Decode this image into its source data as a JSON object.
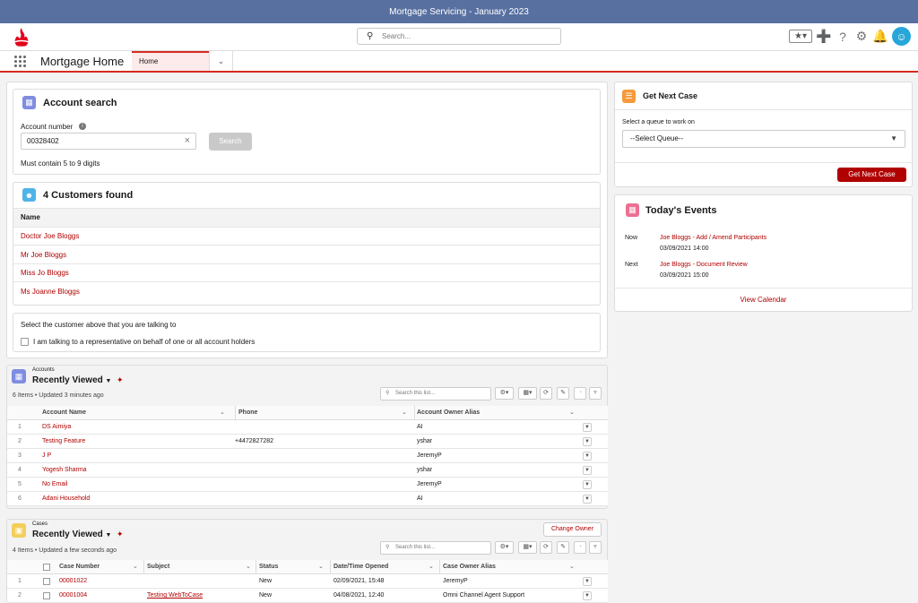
{
  "window": {
    "title": "Mortgage Servicing - January 2023"
  },
  "header": {
    "search_placeholder": "Search..."
  },
  "nav": {
    "app_name": "Mortgage Home",
    "tab_label": "Home"
  },
  "account_search": {
    "title": "Account search",
    "field_label": "Account number",
    "field_value": "00328402",
    "button": "Search",
    "hint": "Must contain 5 to 9 digits"
  },
  "customers": {
    "title": "4 Customers found",
    "col_name": "Name",
    "items": [
      "Doctor Joe Bloggs",
      "Mr Joe Bloggs",
      "Miss Jo Bloggs",
      "Ms Joanne Bloggs"
    ]
  },
  "select_note": {
    "text": "Select the customer above that you are talking to",
    "checkbox_label": "I am talking to a representative on behalf of one or all account holders"
  },
  "next_case": {
    "title": "Get Next Case",
    "label": "Select a queue to work on",
    "select_value": "--Select Queue--",
    "button": "Get Next Case"
  },
  "events": {
    "title": "Today's Events",
    "items": [
      {
        "when": "Now",
        "subject": "Joe Bloggs - Add / Amend Participants",
        "time": "03/09/2021 14:00"
      },
      {
        "when": "Next",
        "subject": "Joe Bloggs - Document Review",
        "time": "03/09/2021 15:00"
      }
    ],
    "link": "View Calendar"
  },
  "accounts": {
    "object": "Accounts",
    "view": "Recently Viewed",
    "meta": "6 Items • Updated 3 minutes ago",
    "search_placeholder": "Search this list...",
    "columns": [
      "Account Name",
      "Phone",
      "Account Owner Alias"
    ],
    "rows": [
      {
        "n": "1",
        "name": "DS Aimiya",
        "phone": "",
        "alias": "AI"
      },
      {
        "n": "2",
        "name": "Testing Feature",
        "phone": "+4472827282",
        "alias": "yshar"
      },
      {
        "n": "3",
        "name": "J P",
        "phone": "",
        "alias": "JeremyP"
      },
      {
        "n": "4",
        "name": "Yogesh Sharma",
        "phone": "",
        "alias": "yshar"
      },
      {
        "n": "5",
        "name": "No Email",
        "phone": "",
        "alias": "JeremyP"
      },
      {
        "n": "6",
        "name": "Adani Household",
        "phone": "",
        "alias": "AI"
      }
    ]
  },
  "cases": {
    "object": "Cases",
    "view": "Recently Viewed",
    "meta": "4 Items • Updated a few seconds ago",
    "search_placeholder": "Search this list...",
    "change_owner": "Change Owner",
    "columns": [
      "Case Number",
      "Subject",
      "Status",
      "Date/Time Opened",
      "Case Owner Alias"
    ],
    "rows": [
      {
        "n": "1",
        "number": "00001022",
        "subject": "",
        "status": "New",
        "opened": "02/09/2021, 15:48",
        "alias": "JeremyP"
      },
      {
        "n": "2",
        "number": "00001004",
        "subject": "Testing WebToCase",
        "status": "New",
        "opened": "04/08/2021, 12:40",
        "alias": "Omni Channel Agent Support"
      }
    ]
  }
}
